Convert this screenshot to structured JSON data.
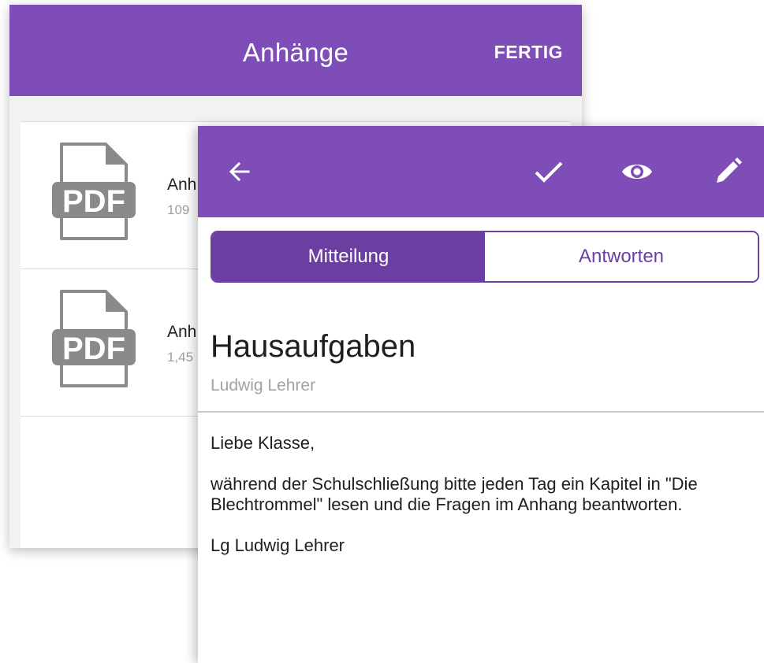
{
  "attachments_screen": {
    "title": "Anhänge",
    "done_label": "FERTIG",
    "items": [
      {
        "icon": "pdf-file-icon",
        "icon_text": "PDF",
        "name": "Anh",
        "size": "109"
      },
      {
        "icon": "pdf-file-icon",
        "icon_text": "PDF",
        "name": "Anh",
        "size": "1,45"
      }
    ]
  },
  "message_screen": {
    "toolbar_icons": [
      "back-arrow-icon",
      "check-icon",
      "eye-icon",
      "pencil-icon"
    ],
    "tabs": [
      {
        "label": "Mitteilung",
        "active": true
      },
      {
        "label": "Antworten",
        "active": false
      }
    ],
    "title": "Hausaufgaben",
    "author": "Ludwig Lehrer",
    "body": {
      "greeting": "Liebe Klasse,",
      "paragraph": "während der Schulschließung bitte jeden Tag ein Kapitel in \"Die Blechtrommel\" lesen und die Fragen im Anhang beantworten.",
      "signature": "Lg Ludwig Lehrer"
    }
  },
  "colors": {
    "header_purple": "#7e4db7",
    "tab_purple": "#6b3fa2",
    "pdf_gray": "#8a8a8a"
  }
}
